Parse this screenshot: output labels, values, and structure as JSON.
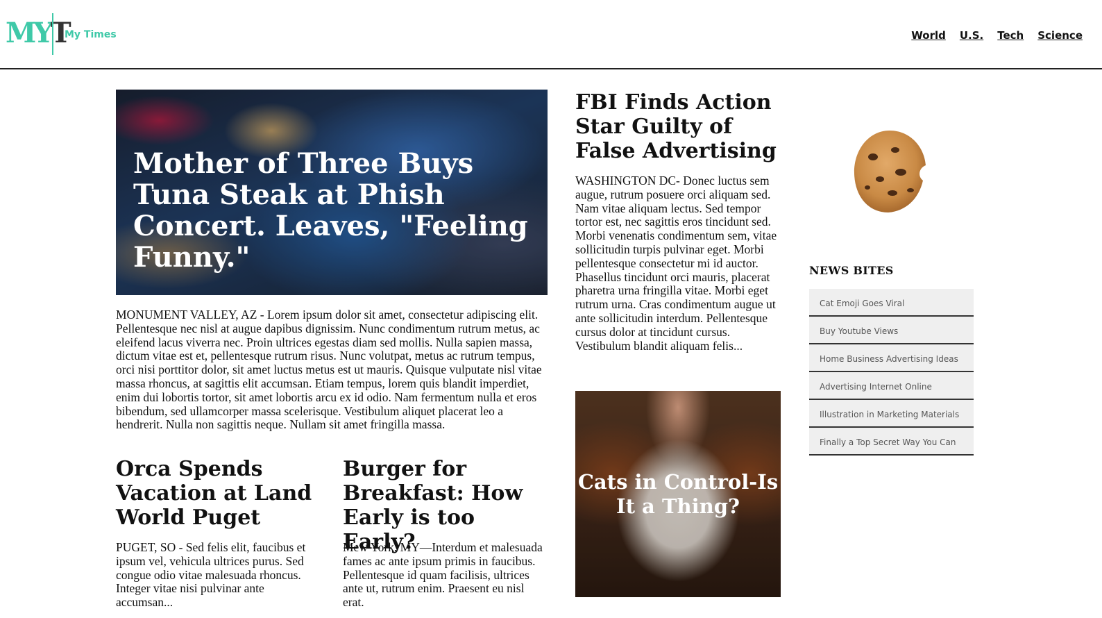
{
  "header": {
    "logo_m": "M",
    "logo_y": "Y",
    "logo_t": "T",
    "brand": "My Times",
    "nav": [
      "World",
      "U.S.",
      "Tech",
      "Science"
    ]
  },
  "hero": {
    "title": "Mother of Three Buys Tuna Steak at Phish Concert. Leaves, \"Feeling Funny.\"",
    "body": "MONUMENT VALLEY, AZ - Lorem ipsum dolor sit amet, consectetur adipiscing elit. Pellentesque nec nisl at augue dapibus dignissim. Nunc condimentum rutrum metus, ac eleifend lacus viverra nec. Proin ultrices egestas diam sed mollis. Nulla sapien massa, dictum vitae est et, pellentesque rutrum risus. Nunc volutpat, metus ac rutrum tempus, orci nisi porttitor dolor, sit amet luctus metus est ut mauris. Quisque vulputate nisl vitae massa rhoncus, at sagittis elit accumsan. Etiam tempus, lorem quis blandit imperdiet, enim dui lobortis tortor, sit amet lobortis arcu ex id odio. Nam fermentum nulla et eros bibendum, sed ullamcorper massa scelerisque. Vestibulum aliquet placerat leo a hendrerit. Nulla non sagittis neque. Nullam sit amet fringilla massa."
  },
  "articles": {
    "fbi": {
      "title": "FBI Finds Action Star Guilty of False Advertising",
      "body": "WASHINGTON DC- Donec luctus sem augue, rutrum posuere orci aliquam sed. Nam vitae aliquam lectus. Sed tempor tortor est, nec sagittis eros tincidunt sed. Morbi venenatis condimentum sem, vitae sollicitudin turpis pulvinar eget. Morbi pellentesque consectetur mi id auctor. Phasellus tincidunt orci mauris, placerat pharetra urna fringilla vitae. Morbi eget rutrum urna. Cras condimentum augue ut ante sollicitudin interdum. Pellentesque cursus dolor at tincidunt cursus. Vestibulum blandit aliquam felis..."
    },
    "orca": {
      "title": "Orca Spends Vacation at Land World Puget",
      "body": "PUGET, SO - Sed felis elit, faucibus et ipsum vel, vehicula ultrices purus. Sed congue odio vitae malesuada rhoncus. Integer vitae nisi pulvinar ante accumsan..."
    },
    "burger": {
      "title": "Burger for Breakfast: How Early is too Early?",
      "body": "Mew York, MY—Interdum et malesuada fames ac ante ipsum primis in faucibus. Pellentesque id quam facilisis, ultrices ante ut, rutrum enim. Praesent eu nisl erat."
    },
    "cats": {
      "title": "Cats in Control-Is It a Thing?"
    }
  },
  "sidebar": {
    "heading": "NEWS BITES",
    "items": [
      "Cat Emoji Goes Viral",
      "Buy Youtube Views",
      "Home Business Advertising Ideas",
      "Advertising Internet Online",
      "Illustration in Marketing Materials",
      "Finally a Top Secret Way You Can"
    ]
  },
  "colors": {
    "accent": "#3fc9a8",
    "text": "#111111",
    "bite_bg": "#efefef"
  }
}
